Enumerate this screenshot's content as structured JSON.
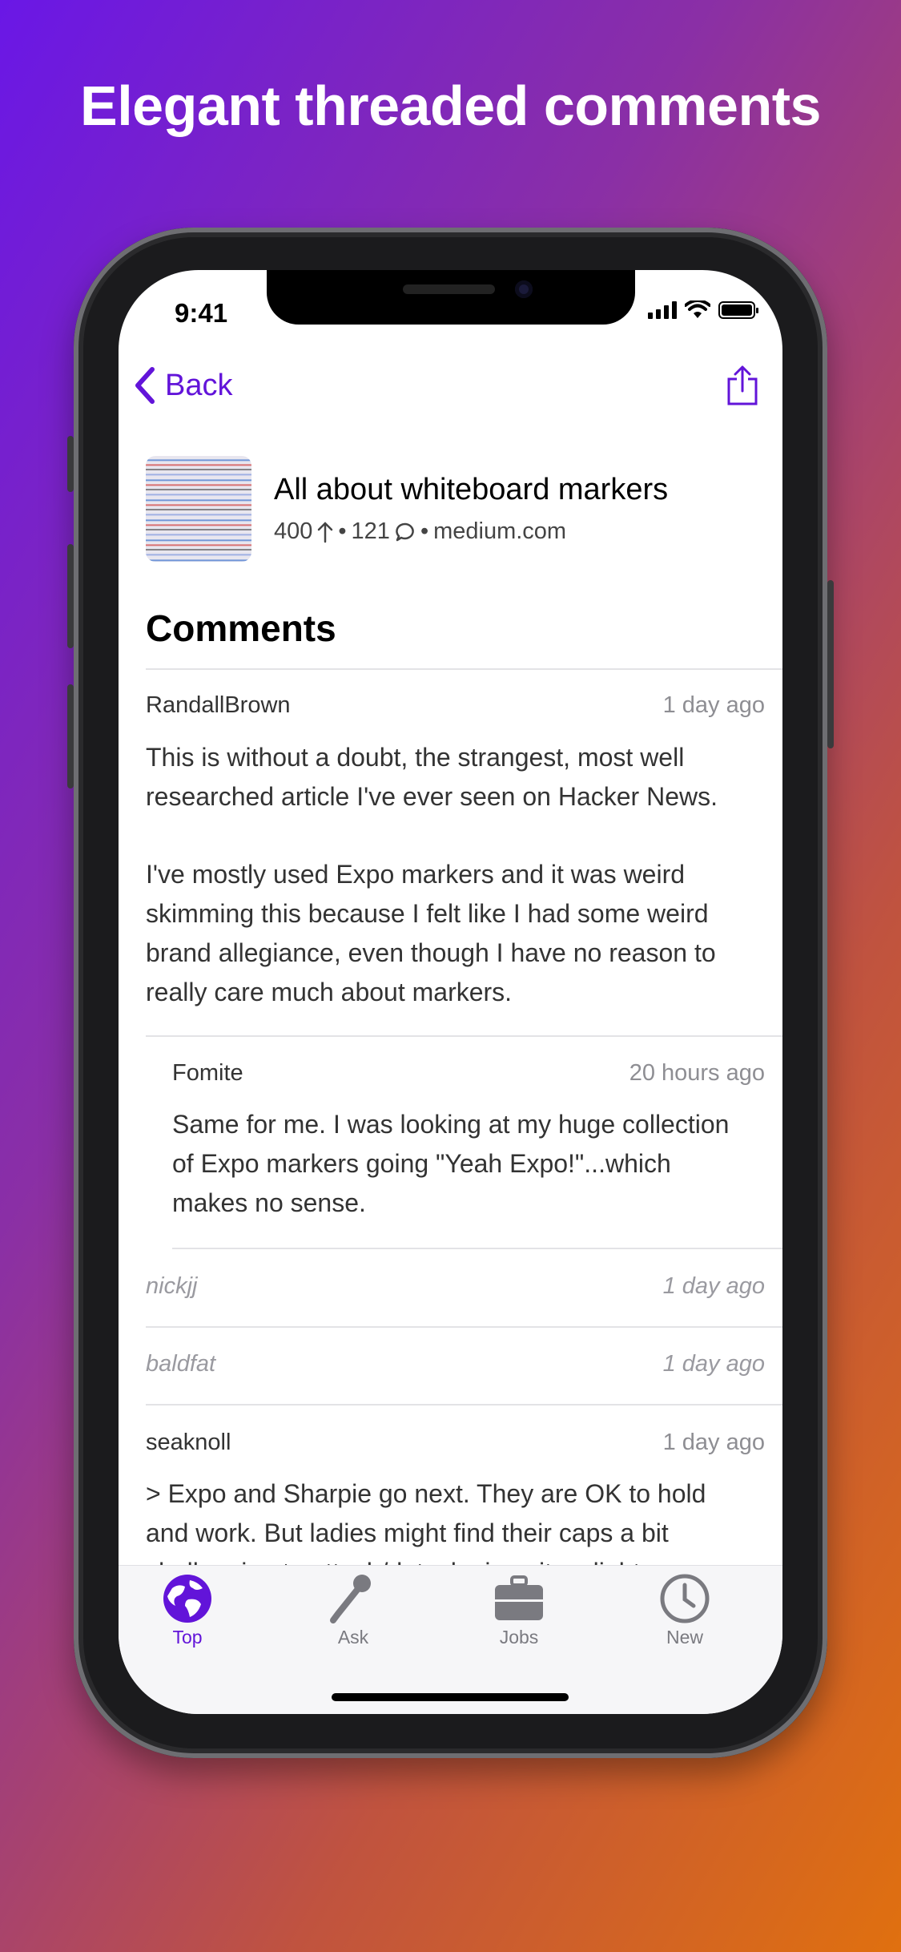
{
  "headline": "Elegant threaded comments",
  "status": {
    "time": "9:41"
  },
  "nav": {
    "back_label": "Back"
  },
  "article": {
    "title": "All about whiteboard markers",
    "points": "400",
    "comments_count": "121",
    "separator": "•",
    "domain": "medium.com"
  },
  "section_title": "Comments",
  "comments": [
    {
      "author": "RandallBrown",
      "time": "1 day ago",
      "body1": "This is without a doubt, the strangest, most well researched article I've ever seen on Hacker News.",
      "body2": "I've mostly used Expo markers and it was weird skimming this because I felt like I had some weird brand allegiance, even though I have no reason to really care much about markers."
    },
    {
      "author": "Fomite",
      "time": "20 hours ago",
      "body1": "Same for me. I was looking at my huge collection of Expo markers going \"Yeah Expo!\"...which makes no sense."
    },
    {
      "author": "nickjj",
      "time": "1 day ago"
    },
    {
      "author": "baldfat",
      "time": "1 day ago"
    },
    {
      "author": "seaknoll",
      "time": "1 day ago",
      "body1": "> Expo and Sharpie go next. They are OK to hold and work. But ladies might find their caps a bit challenging to attach/detach since it a slight"
    }
  ],
  "tabs": [
    {
      "label": "Top",
      "icon": "globe-icon",
      "active": true
    },
    {
      "label": "Ask",
      "icon": "microphone-icon",
      "active": false
    },
    {
      "label": "Jobs",
      "icon": "briefcase-icon",
      "active": false
    },
    {
      "label": "New",
      "icon": "clock-icon",
      "active": false
    }
  ],
  "colors": {
    "accent": "#6214d9",
    "gradient_start": "#6a17e6",
    "gradient_end": "#e0700f"
  }
}
